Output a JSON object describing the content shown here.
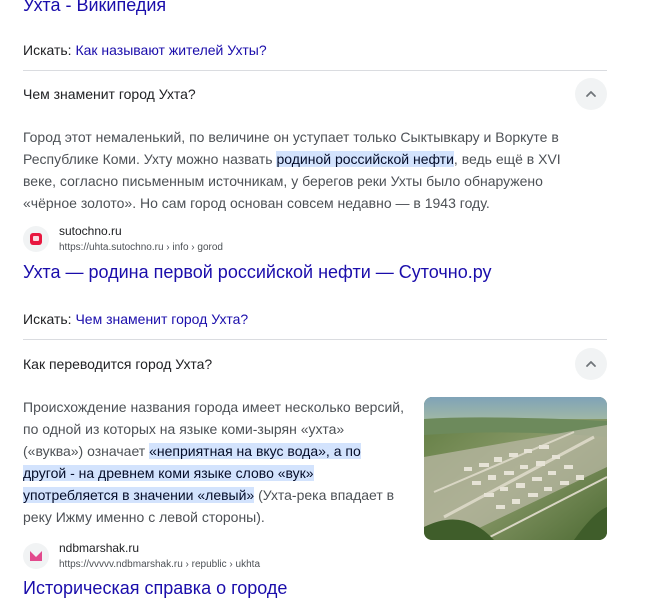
{
  "top": {
    "title": "Ухта - Википедия"
  },
  "search1": {
    "label": "Искать:",
    "query": "Как называют жителей Ухты?"
  },
  "faq1": {
    "question": "Чем знаменит город Ухта?",
    "answer_pre": "Город этот немаленький, по величине он уступает только Сыктывкару и Воркуте в Республике Коми. Ухту можно назвать ",
    "answer_hl": "родиной российской нефти",
    "answer_post": ", ведь ещё в XVI веке, согласно письменным источникам, у берегов реки Ухты было обнаружено «чёрное золото». Но сам город основан совсем недавно — в 1943 году.",
    "source": {
      "name": "sutochno.ru",
      "url": "https://uhta.sutochno.ru › info › gorod",
      "title": "Ухта — родина первой российской нефти — Суточно.ру"
    }
  },
  "search2": {
    "label": "Искать:",
    "query": "Чем знаменит город Ухта?"
  },
  "faq2": {
    "question": "Как переводится город Ухта?",
    "answer_pre": "Происхождение названия города имеет несколько версий, по одной из которых на языке коми-зырян «ухта» («вуква») означает ",
    "answer_hl": "«неприятная на вкус вода», а по другой - на древнем коми языке слово «вук» употребляется в значении «левый»",
    "answer_post": " (Ухта-река впадает в реку Ижму именно с левой стороны).",
    "source": {
      "name": "ndbmarshak.ru",
      "url": "https://vvvvv.ndbmarshak.ru › republic › ukhta",
      "title": "Историческая справка о городе"
    }
  },
  "colors": {
    "link": "#1a0dab",
    "highlight": "#d3e3fd",
    "divider": "#dadce0"
  }
}
